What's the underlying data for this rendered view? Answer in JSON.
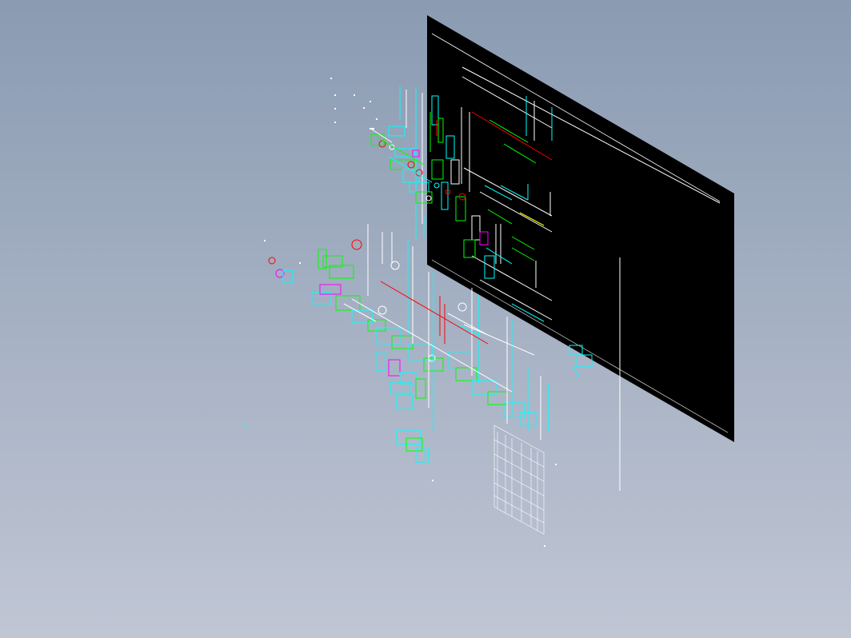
{
  "viewport": {
    "background_top": "#8a9bb2",
    "background_bottom": "#c0c6d4"
  },
  "drawing": {
    "sheet_color": "#000000",
    "sheet_line_color": "#ffffff",
    "palette": {
      "cyan": "#00ffff",
      "green": "#00ff00",
      "red": "#ff0000",
      "magenta": "#ff00ff",
      "white": "#ffffff",
      "yellow": "#ffff00"
    }
  }
}
